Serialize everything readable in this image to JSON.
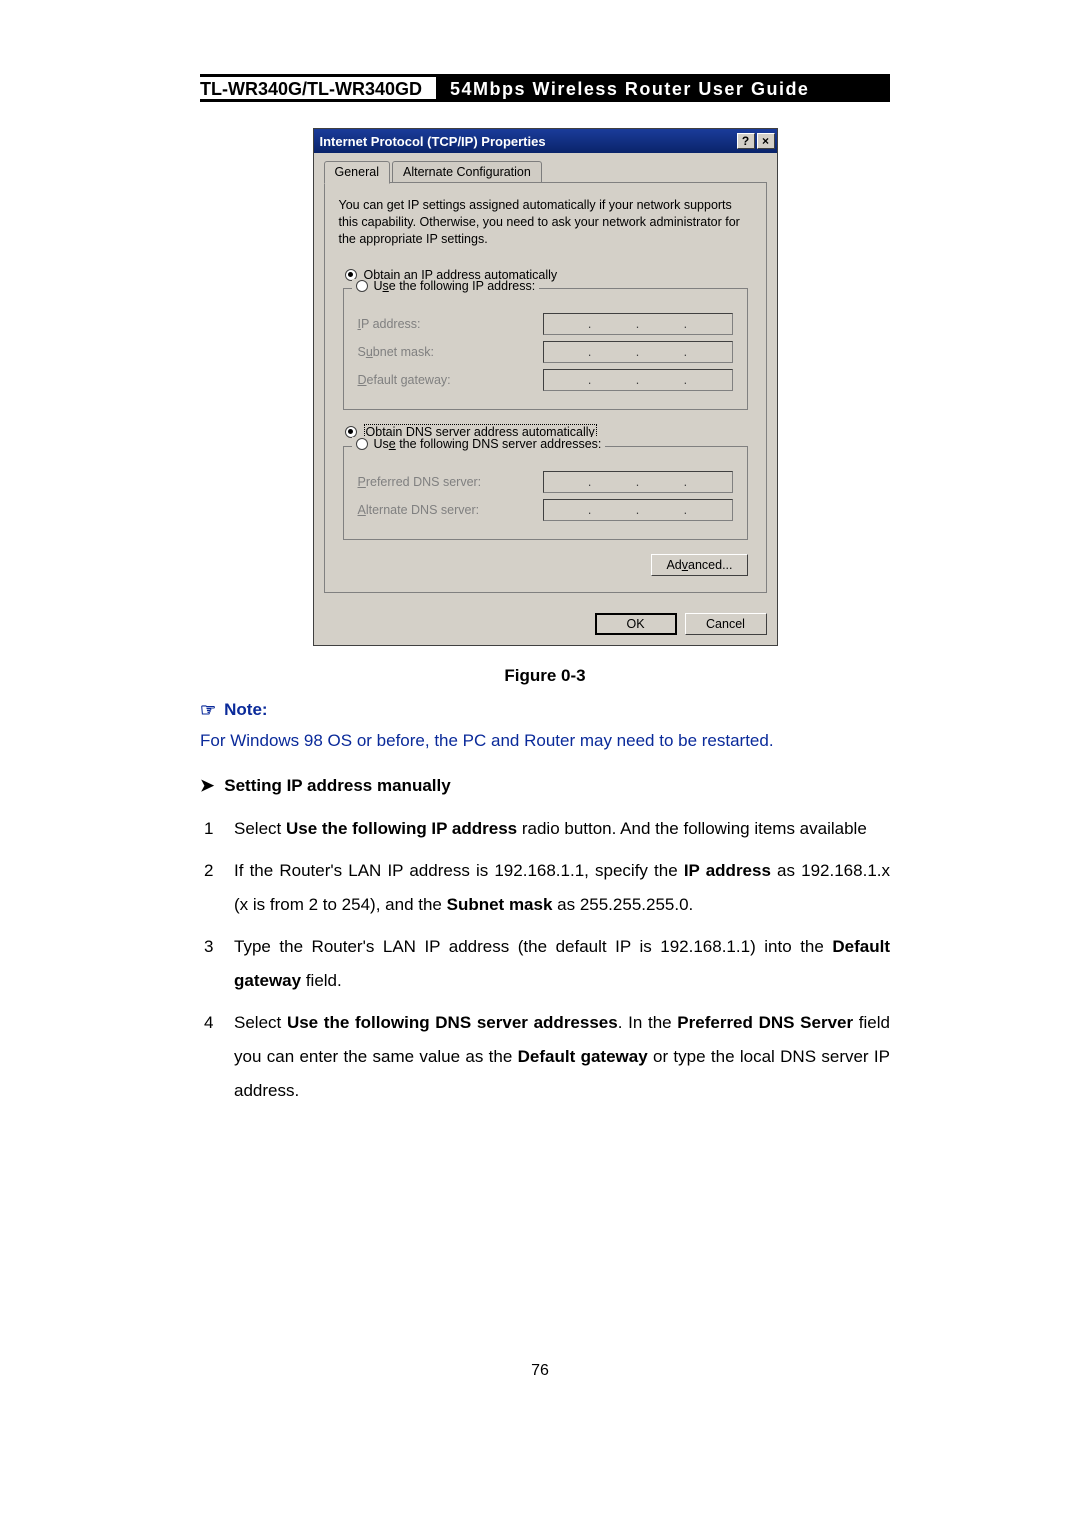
{
  "header": {
    "model": "TL-WR340G/TL-WR340GD",
    "title": "54Mbps Wireless Router User Guide"
  },
  "dialog": {
    "title": "Internet Protocol (TCP/IP) Properties",
    "help_btn": "?",
    "close_btn": "×",
    "tabs": {
      "general": "General",
      "alt": "Alternate Configuration"
    },
    "intro": "You can get IP settings assigned automatically if your network supports this capability. Otherwise, you need to ask your network administrator for the appropriate IP settings.",
    "ip_section": {
      "obtain_pre": "O",
      "obtain_rest": "btain an IP address automatically",
      "use_pre": "U",
      "use_mid": "s",
      "use_rest": "e the following IP address:",
      "ip_label_pre": "I",
      "ip_label_rest": "P address:",
      "subnet_pre": "S",
      "subnet_mid": "u",
      "subnet_rest": "bnet mask:",
      "gw_pre": "D",
      "gw_rest": "efault gateway:"
    },
    "dns_section": {
      "obtain_pre": "O",
      "obtain_mid": "b",
      "obtain_rest": "tain DNS server address automatically",
      "use_pre": "Us",
      "use_mid": "e",
      "use_rest": " the following DNS server addresses:",
      "pref_pre": "P",
      "pref_rest": "referred DNS server:",
      "alt_pre": "A",
      "alt_rest": "lternate DNS server:"
    },
    "advanced_pre": "Ad",
    "advanced_mid": "v",
    "advanced_rest": "anced...",
    "ok": "OK",
    "cancel": "Cancel"
  },
  "caption": "Figure 0-3",
  "note": {
    "label": "Note:",
    "text": "For Windows 98 OS or before, the PC and Router may need to be restarted."
  },
  "section_title": "Setting IP address manually",
  "steps": {
    "s1_a": "Select ",
    "s1_b": "Use the following IP address",
    "s1_c": " radio button. And the following items available",
    "s2_a": "If the Router's LAN IP address is 192.168.1.1, specify the ",
    "s2_b": "IP address",
    "s2_c": " as 192.168.1.x (x is from 2 to 254), and the ",
    "s2_d": "Subnet mask",
    "s2_e": " as 255.255.255.0.",
    "s3_a": "Type the Router's LAN IP address (the default IP is 192.168.1.1) into the ",
    "s3_b": "Default gateway",
    "s3_c": " field.",
    "s4_a": "Select ",
    "s4_b": "Use the following DNS server addresses",
    "s4_c": ".   In the ",
    "s4_d": "Preferred DNS Server",
    "s4_e": " field you can enter the same value as the ",
    "s4_f": "Default gateway",
    "s4_g": " or type the local DNS server IP address."
  },
  "page_number": "76"
}
